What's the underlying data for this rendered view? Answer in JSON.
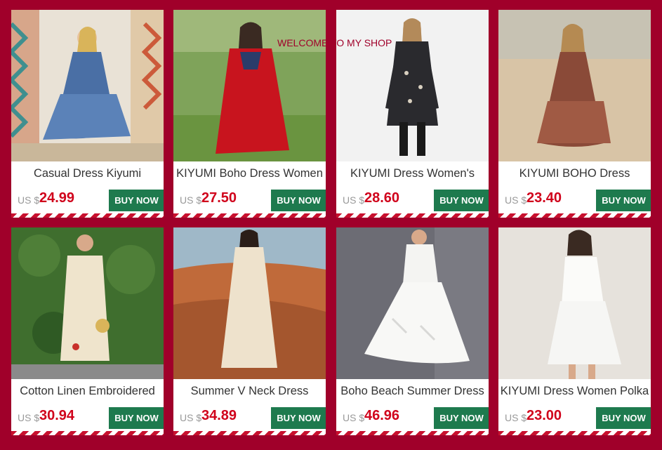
{
  "overlay_text": "WELCOME TO MY SHOP",
  "currency_label": "US $",
  "buy_label": "BUY NOW",
  "products": [
    {
      "title": "Casual Dress Kiyumi",
      "price": "24.99"
    },
    {
      "title": "KIYUMI Boho Dress Women",
      "price": "27.50"
    },
    {
      "title": "KIYUMI Dress Women's",
      "price": "28.60"
    },
    {
      "title": "KIYUMI BOHO Dress",
      "price": "23.40"
    },
    {
      "title": "Cotton Linen Embroidered",
      "price": "30.94"
    },
    {
      "title": "Summer V Neck Dress",
      "price": "34.89"
    },
    {
      "title": "Boho Beach Summer Dress",
      "price": "46.96"
    },
    {
      "title": "KIYUMI Dress Women Polka",
      "price": "23.00"
    }
  ],
  "colors": {
    "background": "#a0002a",
    "price": "#d0021b",
    "button": "#1e7a4e",
    "stripe": "#c8102e"
  }
}
